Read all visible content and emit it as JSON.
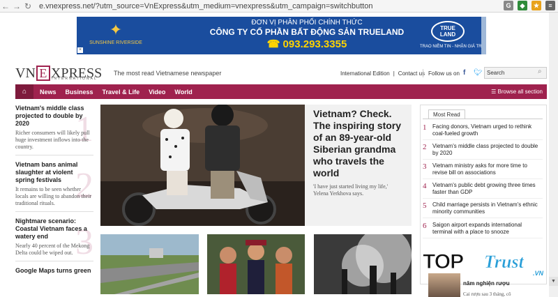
{
  "browser": {
    "url": "e.vnexpress.net/?utm_source=VnExpress&utm_medium=vnexpress&utm_campaign=switchbutton"
  },
  "ad": {
    "logo_text": "SUNSHINE RIVERSIDE",
    "line1": "ĐƠN VỊ PHÂN PHỐI CHÍNH THỨC",
    "line2": "CÔNG TY CỔ PHẦN BẤT ĐỘNG SẢN TRUELAND",
    "phone": "093.293.3355",
    "badge": "TRUE LAND",
    "slogan": "TRAO NIỀM TIN - NHẬN GIÁ TRỊ"
  },
  "header": {
    "logo_vn": "VN",
    "logo_e": "E",
    "logo_rest": "XPRESS",
    "logo_sub": "INTERNATIONAL",
    "tagline": "The most read Vietnamese newspaper",
    "edition": "International Edition",
    "contact": "Contact us",
    "follow": "Follow us on",
    "search_placeholder": "Search"
  },
  "nav": {
    "items": [
      "News",
      "Business",
      "Travel & Life",
      "Video",
      "World"
    ],
    "browse": "Browse all section"
  },
  "left_articles": [
    {
      "num": "1",
      "title": "Vietnam's middle class projected to double by 2020",
      "desc": "Richer consumers will likely pull huge investment inflows into the country."
    },
    {
      "num": "2",
      "title": "Vietnam bans animal slaughter at violent spring festivals",
      "desc": "It remains to be seen whether locals are willing to abandon their traditional rituals."
    },
    {
      "num": "3",
      "title": "Nightmare scenario: Coastal Vietnam faces a watery end",
      "desc": "Nearly 40 percent of the Mekong Delta could be wiped out."
    },
    {
      "num": "",
      "title": "Google Maps turns green",
      "desc": ""
    }
  ],
  "featured": {
    "title": "Vietnam? Check. The inspiring story of an 89-year-old Siberian grandma who travels the world",
    "desc": "'I have just started living my life,' Yelena Yerkhova says."
  },
  "most_read": {
    "tab": "Most Read",
    "items": [
      {
        "num": "1",
        "text": "Facing donors, Vietnam urged to rethink coal-fueled growth"
      },
      {
        "num": "2",
        "text": "Vietnam's middle class projected to double by 2020"
      },
      {
        "num": "3",
        "text": "Vietnam ministry asks for more time to revise bill on associations"
      },
      {
        "num": "4",
        "text": "Vietnam's public debt growing three times faster than GDP"
      },
      {
        "num": "5",
        "text": "Child marriage persists in Vietnam's ethnic minority communities"
      },
      {
        "num": "6",
        "text": "Saigon airport expands international terminal with a place to snooze"
      }
    ]
  },
  "watermark": {
    "top": "TOP",
    "trust": "Trust",
    "vn": ".VN"
  },
  "below_watermark": {
    "title": "năm nghiện rượu",
    "desc": "Cai rượu sau 3 tháng, cô"
  }
}
